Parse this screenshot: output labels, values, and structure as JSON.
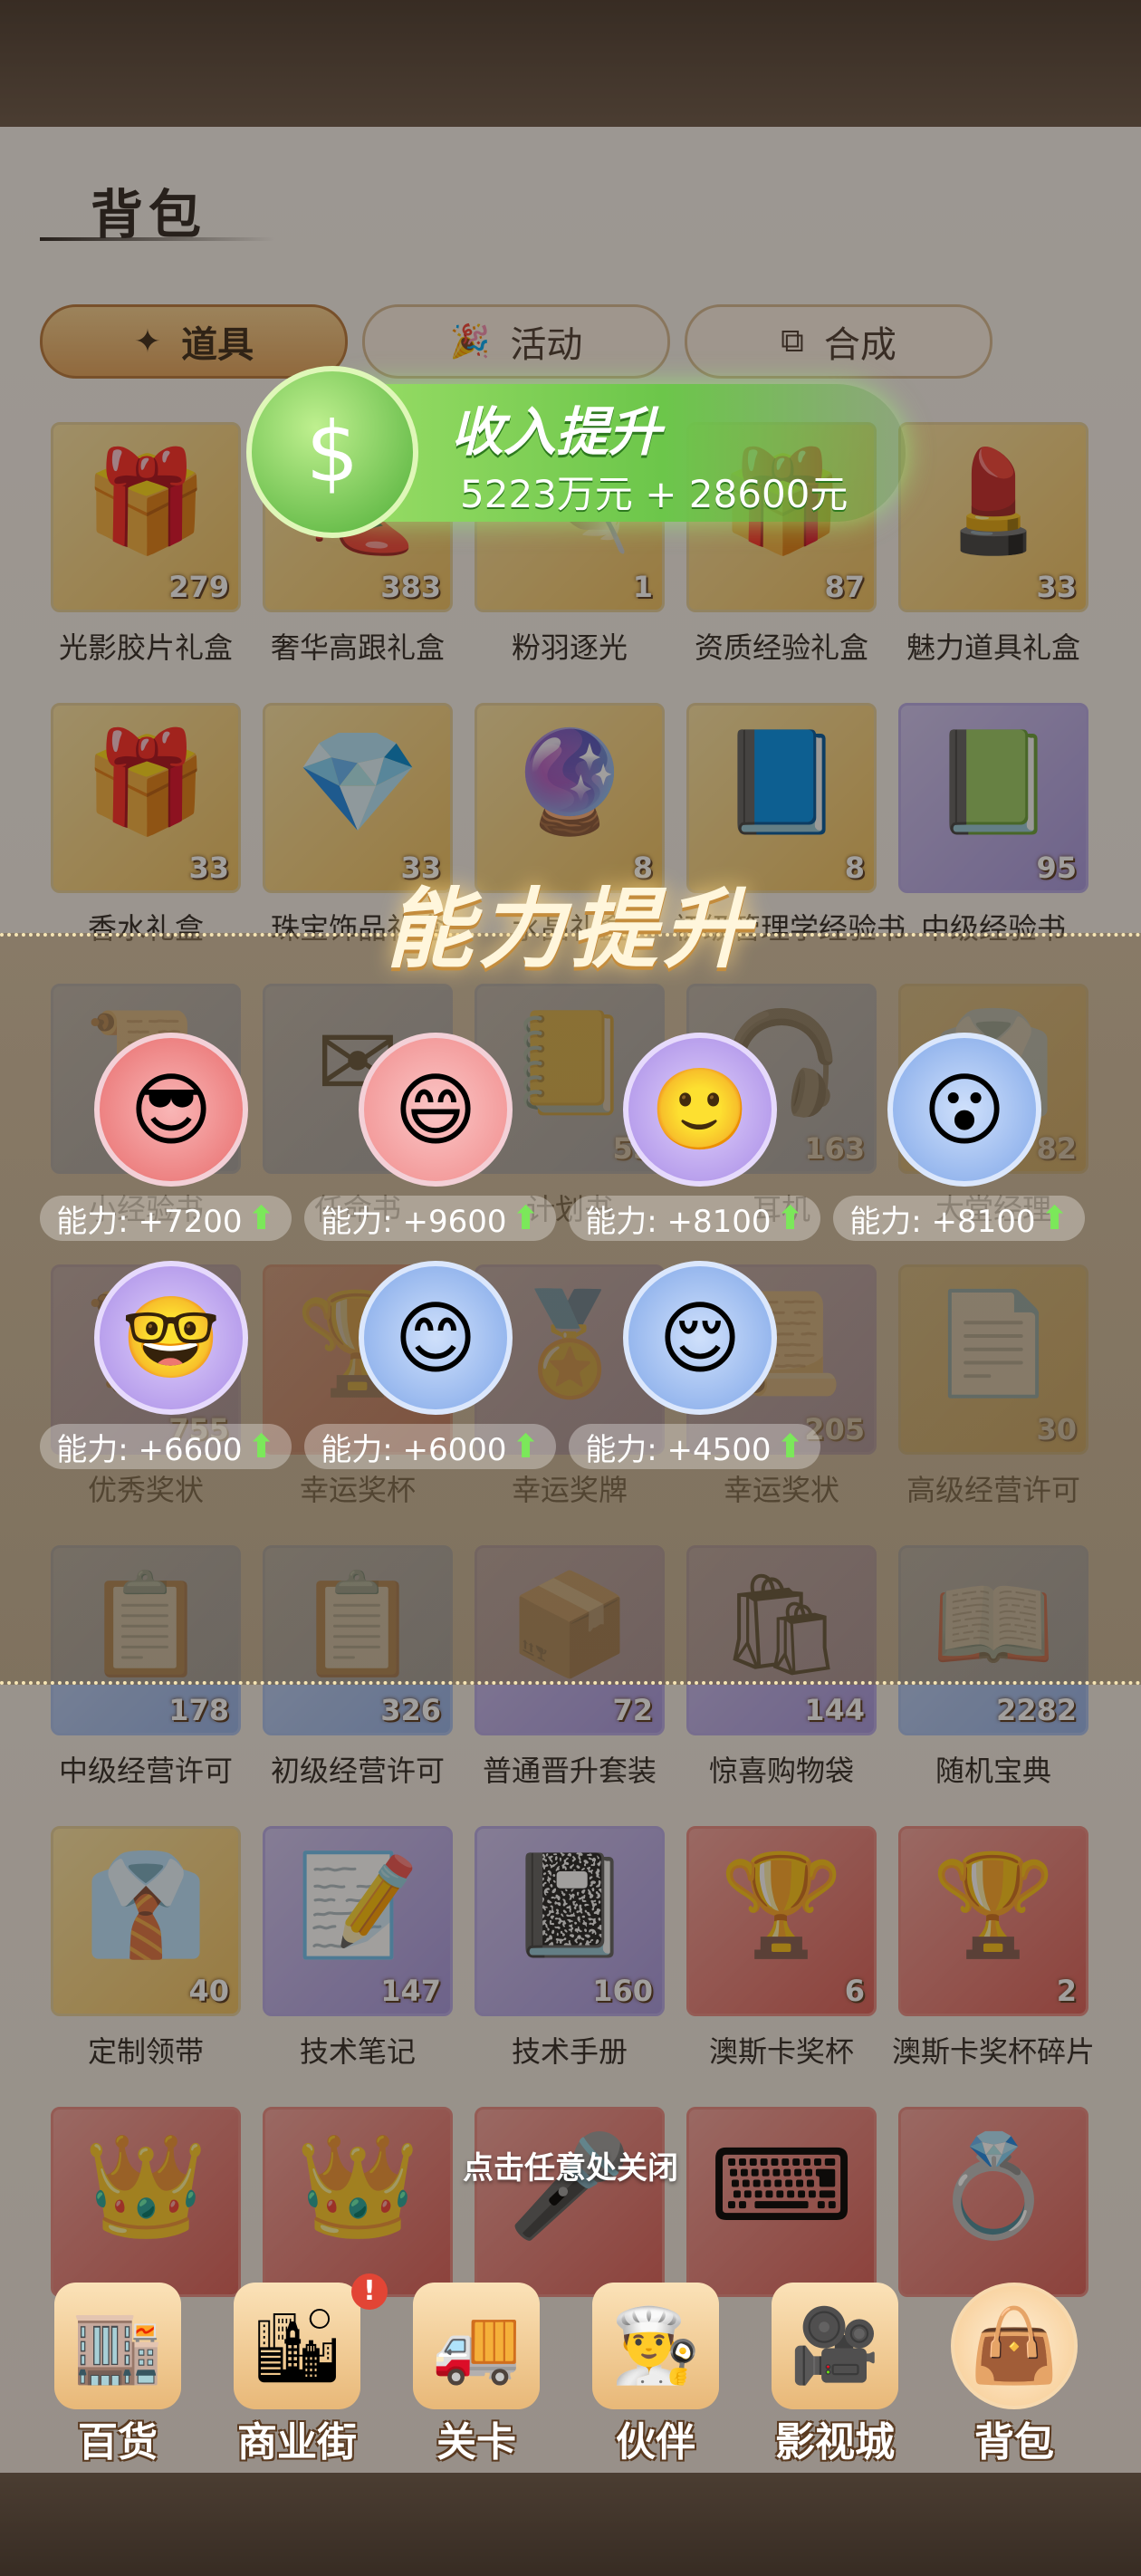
{
  "panel": {
    "title": "背包"
  },
  "tabs": [
    {
      "label": "道具",
      "icon": "magic-wand-icon",
      "active": true
    },
    {
      "label": "活动",
      "icon": "party-popper-icon",
      "active": false
    },
    {
      "label": "合成",
      "icon": "merge-squares-icon",
      "active": false
    }
  ],
  "items": [
    [
      {
        "name": "光影胶片礼盒",
        "count": "279",
        "icon": "film-gift-box-icon",
        "color": "gold"
      },
      {
        "name": "奢华高跟礼盒",
        "count": "383",
        "icon": "heels-gift-box-icon",
        "color": "gold"
      },
      {
        "name": "粉羽逐光",
        "count": "1",
        "icon": "pink-feather-icon",
        "color": "gold"
      },
      {
        "name": "资质经验礼盒",
        "count": "87",
        "icon": "gift-box-icon",
        "color": "gold"
      },
      {
        "name": "魅力道具礼盒",
        "count": "33",
        "icon": "cosmetics-gift-box-icon",
        "color": "gold"
      }
    ],
    [
      {
        "name": "香水礼盒",
        "count": "33",
        "icon": "perfume-gift-box-icon",
        "color": "gold"
      },
      {
        "name": "珠宝饰品礼盒",
        "count": "33",
        "icon": "jewelry-gift-box-icon",
        "color": "gold"
      },
      {
        "name": "水晶礼盒",
        "count": "8",
        "icon": "crystal-gift-box-icon",
        "color": "gold"
      },
      {
        "name": "初级管理学经验书",
        "count": "8",
        "icon": "management-book-icon",
        "color": "gold"
      },
      {
        "name": "中级经验书",
        "count": "95",
        "icon": "advanced-management-book-icon",
        "color": "purple"
      }
    ],
    [
      {
        "name": "小经验书",
        "count": "",
        "icon": "certificate-icon",
        "color": "blue"
      },
      {
        "name": "任命书",
        "count": "",
        "icon": "letter-icon",
        "color": "blue"
      },
      {
        "name": "计划书",
        "count": "55",
        "icon": "plan-book-icon",
        "color": "blue"
      },
      {
        "name": "耳机",
        "count": "163",
        "icon": "headphones-icon",
        "color": "blue"
      },
      {
        "name": "大堂经理",
        "count": "82",
        "icon": "manager-icon",
        "color": "gold"
      }
    ],
    [
      {
        "name": "优秀奖状",
        "count": "755",
        "icon": "award-certificate-icon",
        "color": "purple"
      },
      {
        "name": "幸运奖杯",
        "count": "",
        "icon": "lucky-trophy-icon",
        "color": "red"
      },
      {
        "name": "幸运奖牌",
        "count": "",
        "icon": "lucky-medal-icon",
        "color": "purple"
      },
      {
        "name": "幸运奖状",
        "count": "205",
        "icon": "lucky-certificate-icon",
        "color": "purple"
      },
      {
        "name": "高级经营许可",
        "count": "30",
        "icon": "permit-document-icon",
        "color": "gold"
      }
    ],
    [
      {
        "name": "中级经营许可",
        "count": "178",
        "icon": "clipboard-permit-icon",
        "color": "blue"
      },
      {
        "name": "初级经营许可",
        "count": "326",
        "icon": "clipboard-permit-icon",
        "color": "blue"
      },
      {
        "name": "普通晋升套装",
        "count": "72",
        "icon": "promotion-set-icon",
        "color": "purple"
      },
      {
        "name": "惊喜购物袋",
        "count": "144",
        "icon": "shopping-bag-icon",
        "color": "purple"
      },
      {
        "name": "随机宝典",
        "count": "2282",
        "icon": "mystery-book-icon",
        "color": "blue"
      }
    ],
    [
      {
        "name": "定制领带",
        "count": "40",
        "icon": "necktie-box-icon",
        "color": "gold"
      },
      {
        "name": "技术笔记",
        "count": "147",
        "icon": "technical-notes-icon",
        "color": "purple"
      },
      {
        "name": "技术手册",
        "count": "160",
        "icon": "technical-manual-icon",
        "color": "purple"
      },
      {
        "name": "澳斯卡奖杯",
        "count": "6",
        "icon": "oscar-trophy-icon",
        "color": "red"
      },
      {
        "name": "澳斯卡奖杯碎片",
        "count": "2",
        "icon": "oscar-trophy-fragment-icon",
        "color": "red"
      }
    ],
    [
      {
        "name": "",
        "count": "",
        "icon": "crown-icon",
        "color": "red"
      },
      {
        "name": "",
        "count": "",
        "icon": "crown-fragment-icon",
        "color": "red"
      },
      {
        "name": "",
        "count": "",
        "icon": "microphone-icon",
        "color": "red"
      },
      {
        "name": "",
        "count": "",
        "icon": "typewriter-icon",
        "color": "red"
      },
      {
        "name": "",
        "count": "",
        "icon": "ring-box-icon",
        "color": "red"
      }
    ]
  ],
  "income_popup": {
    "title": "收入提升",
    "value": "5223万元 + 28600元",
    "icon": "piggy-bank-icon"
  },
  "ability_popup": {
    "headline": "能力提升",
    "characters": [
      {
        "label": "能力: +7200",
        "icon": "sunglasses-man-avatar-icon",
        "frame": "red"
      },
      {
        "label": "能力: +9600",
        "icon": "smiling-woman-avatar-icon",
        "frame": "pink"
      },
      {
        "label": "能力: +8100",
        "icon": "profile-woman-avatar-icon",
        "frame": "purple"
      },
      {
        "label": "能力: +8100",
        "icon": "maid-woman-avatar-icon",
        "frame": "blue"
      },
      {
        "label": "能力: +6600",
        "icon": "glasses-man-avatar-icon",
        "frame": "purple"
      },
      {
        "label": "能力: +6000",
        "icon": "cap-girl-avatar-icon",
        "frame": "blue"
      },
      {
        "label": "能力: +4500",
        "icon": "headband-woman-avatar-icon",
        "frame": "blue"
      }
    ]
  },
  "close_hint": "点击任意处关闭",
  "nav": [
    {
      "label": "百货",
      "icon": "department-store-icon",
      "badge": ""
    },
    {
      "label": "商业街",
      "icon": "business-street-icon",
      "badge": "!"
    },
    {
      "label": "关卡",
      "icon": "delivery-truck-icon",
      "badge": ""
    },
    {
      "label": "伙伴",
      "icon": "chef-partner-icon",
      "badge": ""
    },
    {
      "label": "影视城",
      "icon": "film-camera-icon",
      "badge": ""
    },
    {
      "label": "背包",
      "icon": "backpack-icon",
      "badge": "",
      "active": true
    }
  ],
  "colors": {
    "accent_tab": "#e3a35b",
    "income_green": "#6cc64a",
    "ability_arrow": "#7be85a",
    "badge_red": "#e24535"
  }
}
